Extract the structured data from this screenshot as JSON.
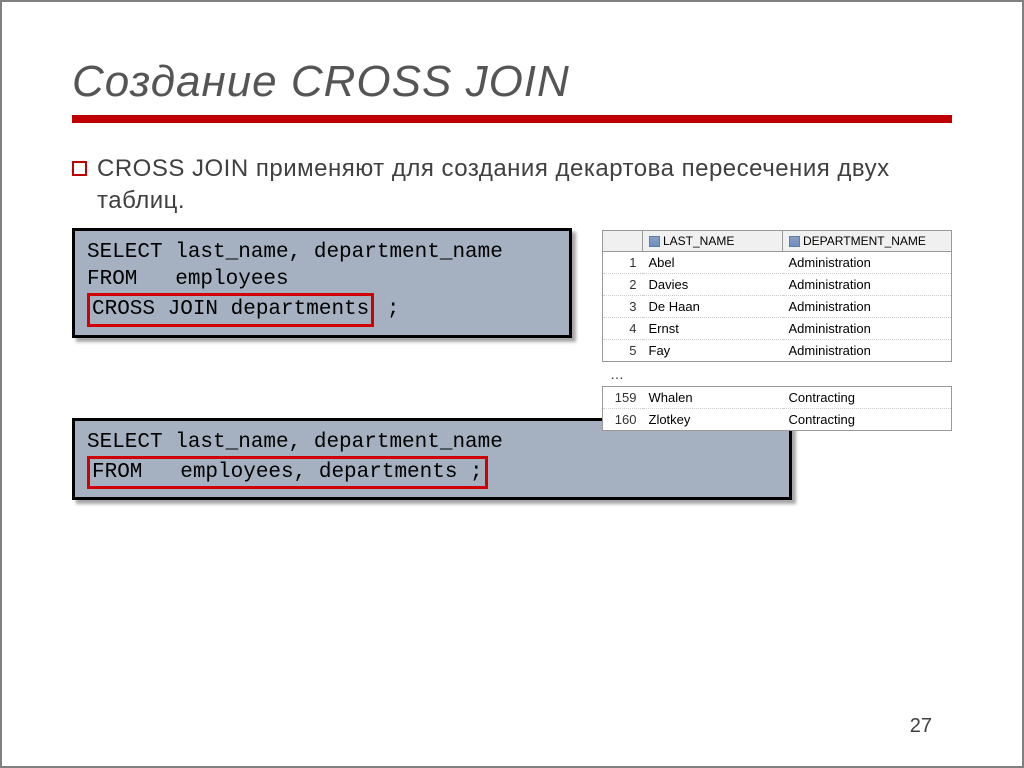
{
  "title": "Создание CROSS JOIN",
  "bullet": "CROSS JOIN применяют для создания декартова пересечения двух таблиц.",
  "code1": {
    "line1": "SELECT last_name, department_name",
    "line2": "FROM   employees",
    "boxed": "CROSS JOIN departments",
    "tail": " ;"
  },
  "code2": {
    "line1": "SELECT last_name, department_name",
    "boxed": "FROM   employees, departments ;"
  },
  "table": {
    "col1": "LAST_NAME",
    "col2": "DEPARTMENT_NAME",
    "rows1": [
      {
        "n": "1",
        "ln": "Abel",
        "dn": "Administration"
      },
      {
        "n": "2",
        "ln": "Davies",
        "dn": "Administration"
      },
      {
        "n": "3",
        "ln": "De Haan",
        "dn": "Administration"
      },
      {
        "n": "4",
        "ln": "Ernst",
        "dn": "Administration"
      },
      {
        "n": "5",
        "ln": "Fay",
        "dn": "Administration"
      }
    ],
    "dots": "…",
    "rows2": [
      {
        "n": "159",
        "ln": "Whalen",
        "dn": "Contracting"
      },
      {
        "n": "160",
        "ln": "Zlotkey",
        "dn": "Contracting"
      }
    ]
  },
  "page": "27"
}
